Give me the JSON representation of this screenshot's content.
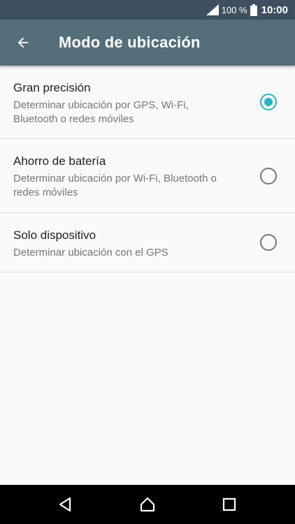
{
  "status_bar": {
    "battery_percent": "100 %",
    "time": "10:00",
    "icons": [
      "signal-icon",
      "battery-icon"
    ]
  },
  "app_bar": {
    "back_icon": "arrow-left-icon",
    "title": "Modo de ubicación"
  },
  "options": [
    {
      "title": "Gran precisión",
      "summary": "Determinar ubicación por GPS, Wi-Fi, Bluetooth o redes móviles",
      "selected": true
    },
    {
      "title": "Ahorro de batería",
      "summary": "Determinar ubicación por Wi-Fi, Bluetooth o redes móviles",
      "selected": false
    },
    {
      "title": "Solo dispositivo",
      "summary": "Determinar ubicación con el GPS",
      "selected": false
    }
  ],
  "nav_bar": {
    "icons": [
      "back-triangle-icon",
      "home-icon",
      "recents-icon"
    ]
  },
  "colors": {
    "status_bar_bg": "#3e5060",
    "app_bar_bg": "#546e7a",
    "accent": "#26b4c5",
    "background": "#fafafa"
  }
}
